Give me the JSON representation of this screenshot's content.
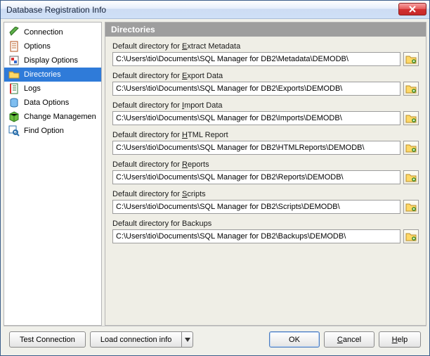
{
  "window": {
    "title": "Database Registration Info"
  },
  "sidebar": {
    "items": [
      {
        "label": "Connection"
      },
      {
        "label": "Options"
      },
      {
        "label": "Display Options"
      },
      {
        "label": "Directories"
      },
      {
        "label": "Logs"
      },
      {
        "label": "Data Options"
      },
      {
        "label": "Change Managemen"
      },
      {
        "label": "Find Option"
      }
    ],
    "selected_index": 3
  },
  "panel": {
    "header": "Directories",
    "fields": [
      {
        "label_prefix": "Default directory for ",
        "mnemonic": "E",
        "label_rest": "xtract Metadata",
        "value": "C:\\Users\\tio\\Documents\\SQL Manager for DB2\\Metadata\\DEMODB\\"
      },
      {
        "label_prefix": "Default directory for ",
        "mnemonic": "E",
        "label_rest": "xport Data",
        "value": "C:\\Users\\tio\\Documents\\SQL Manager for DB2\\Exports\\DEMODB\\"
      },
      {
        "label_prefix": "Default directory for ",
        "mnemonic": "I",
        "label_rest": "mport Data",
        "value": "C:\\Users\\tio\\Documents\\SQL Manager for DB2\\Imports\\DEMODB\\"
      },
      {
        "label_prefix": "Default directory for ",
        "mnemonic": "H",
        "label_rest": "TML Report",
        "value": "C:\\Users\\tio\\Documents\\SQL Manager for DB2\\HTMLReports\\DEMODB\\"
      },
      {
        "label_prefix": "Default directory for ",
        "mnemonic": "R",
        "label_rest": "eports",
        "value": "C:\\Users\\tio\\Documents\\SQL Manager for DB2\\Reports\\DEMODB\\"
      },
      {
        "label_prefix": "Default directory for ",
        "mnemonic": "S",
        "label_rest": "cripts",
        "value": "C:\\Users\\tio\\Documents\\SQL Manager for DB2\\Scripts\\DEMODB\\"
      },
      {
        "label_prefix": "Default directory for Backups",
        "mnemonic": "",
        "label_rest": "",
        "value": "C:\\Users\\tio\\Documents\\SQL Manager for DB2\\Backups\\DEMODB\\"
      }
    ]
  },
  "footer": {
    "test": "Test Connection",
    "load": "Load connection info",
    "ok": "OK",
    "cancel": "Cancel",
    "help": "Help"
  },
  "icons": {
    "connection": "plug",
    "options": "page",
    "display": "display",
    "directories": "folder",
    "logs": "notebook",
    "data": "db",
    "change": "cube",
    "find": "search"
  }
}
